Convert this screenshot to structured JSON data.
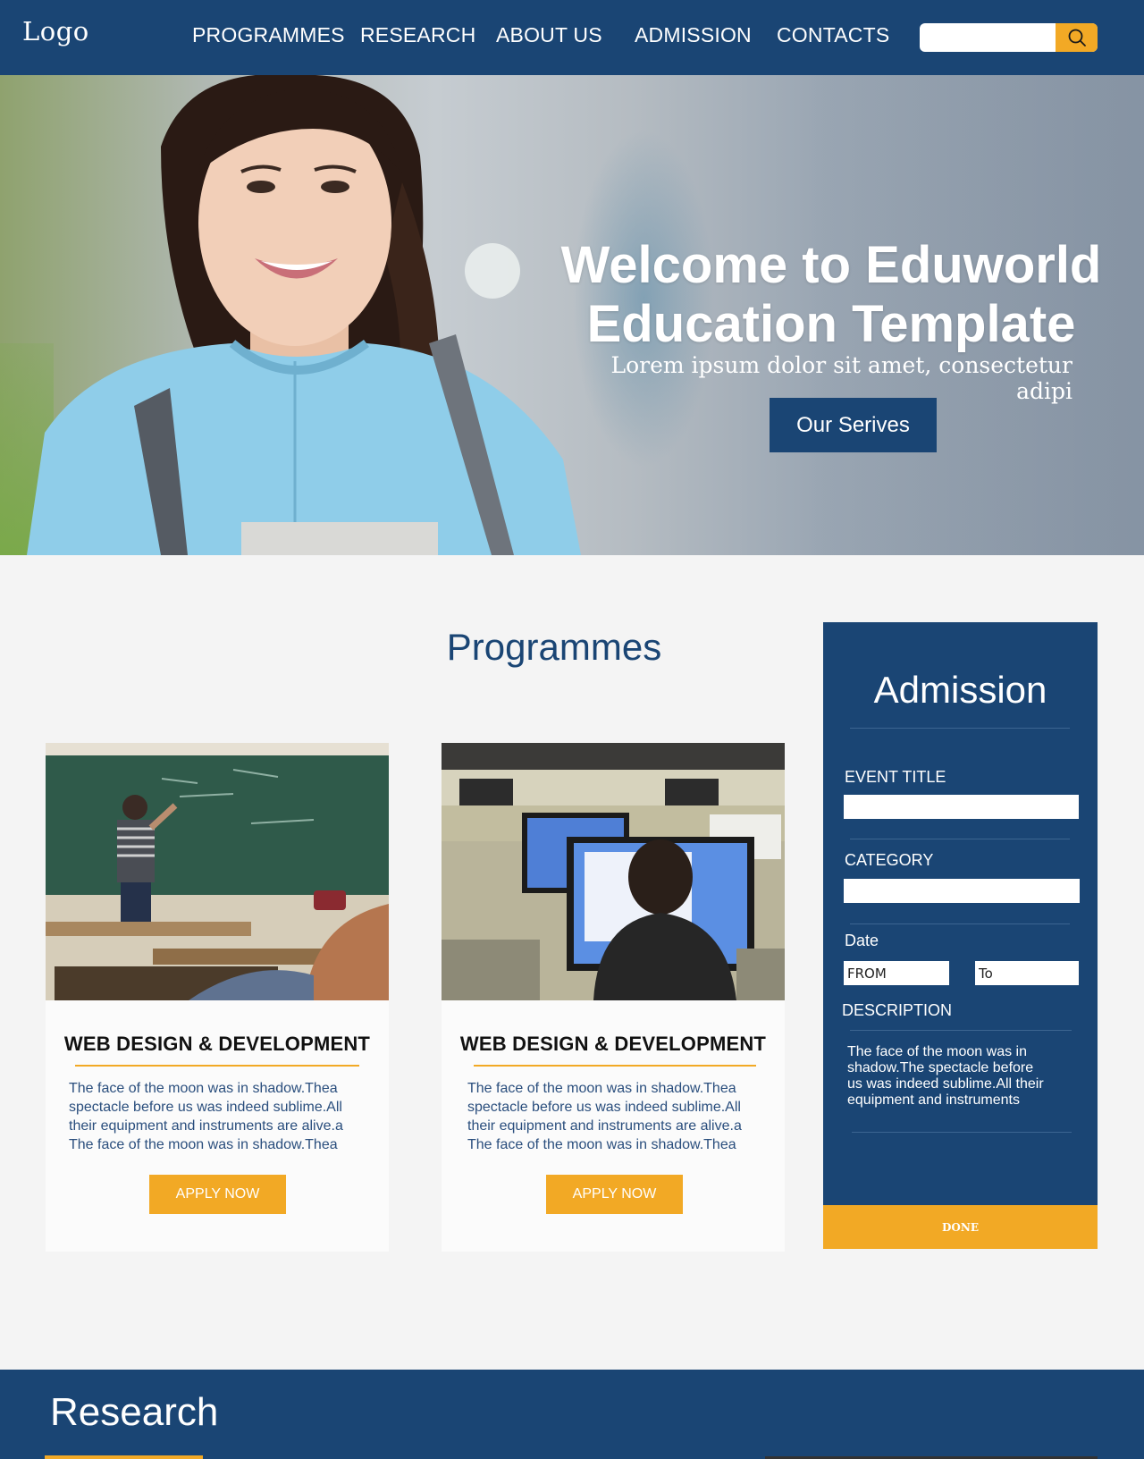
{
  "header": {
    "logo": "Logo",
    "nav": [
      "PROGRAMMES",
      "RESEARCH",
      "ABOUT US",
      "ADMISSION",
      "CONTACTS"
    ],
    "search": {
      "value": "",
      "placeholder": ""
    },
    "icons": {
      "search": "search-icon"
    }
  },
  "hero": {
    "title_line1": "Welcome to Eduworld",
    "title_line2": "Education Template",
    "subtitle": "Lorem ipsum dolor sit amet, consectetur adipi",
    "button": "Our Serives"
  },
  "programmes": {
    "title": "Programmes",
    "cards": [
      {
        "title": "WEB DESIGN & DEVELOPMENT",
        "lines": [
          "The face of the moon was in shadow.Thea",
          "spectacle before us was indeed sublime.All",
          "their equipment and instruments are alive.a",
          "The face of the moon was in shadow.Thea"
        ],
        "button": "APPLY NOW"
      },
      {
        "title": "WEB DESIGN & DEVELOPMENT",
        "lines": [
          "The face of the moon was in shadow.Thea",
          "spectacle before us was indeed sublime.All",
          "their equipment and instruments are alive.a",
          "The face of the moon was in shadow.Thea"
        ],
        "button": "APPLY NOW"
      }
    ]
  },
  "admission": {
    "title": "Admission",
    "event_title_label": "EVENT TITLE",
    "event_title_value": "",
    "category_label": "CATEGORY",
    "category_value": "",
    "date_label": "Date",
    "from_value": "FROM",
    "to_value": "To",
    "description_label": "DESCRIPTION",
    "description_lines": [
      "The face of the moon was in",
      "shadow.The spectacle before",
      "us was indeed sublime.All their",
      "equipment and instruments"
    ],
    "done_button": "DONE"
  },
  "research": {
    "title": "Research"
  },
  "colors": {
    "primary": "#1a4574",
    "accent": "#f2a925",
    "background": "#f4f4f4"
  }
}
